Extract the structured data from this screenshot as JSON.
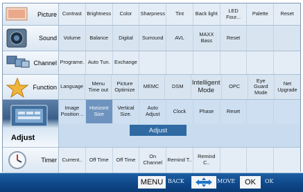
{
  "menu": {
    "rows": [
      {
        "label": "Picture",
        "icon": "picture-icon",
        "items": [
          "Contrast",
          "Brightness",
          "Color",
          "Sharpness",
          "Tint",
          "Back light",
          "LED Four...",
          "Palette",
          "Reset"
        ]
      },
      {
        "label": "Sound",
        "icon": "speaker-icon",
        "items": [
          "Volume",
          "Balance",
          "Digital",
          "Surround",
          "AVL",
          "MAXX Bass",
          "Reset",
          "",
          ""
        ]
      },
      {
        "label": "Channel",
        "icon": "channel-icon",
        "items": [
          "Programe.",
          "Auto Tun.",
          "Exchange",
          "",
          "",
          "",
          "",
          "",
          ""
        ]
      },
      {
        "label": "Function",
        "icon": "star-icon",
        "items": [
          "Language",
          "Menu Time out",
          "Picture Optimize",
          "MEMC",
          "DSM",
          "Intelligent Mode",
          "OPC",
          "Eye Guard Mode",
          "Net Upgrade"
        ]
      },
      {
        "label": "Adjust",
        "icon": "display-icon",
        "items": [
          "Image Position ..",
          "Horizont Size",
          "Vertical Size.",
          "Auto Adjust",
          "Clock",
          "Phase",
          "Reset",
          "",
          ""
        ]
      },
      {
        "label": "Timer",
        "icon": "clock-icon",
        "items": [
          "Current..",
          "Off Time",
          "Off Time",
          "On Channel",
          "Remind T..",
          "Remind C..",
          "",
          "",
          ""
        ]
      }
    ],
    "active_row": "Adjust",
    "selected_item": "Horizont Size",
    "submenu_title": "Adjust"
  },
  "footer": {
    "menu_key": "MENU",
    "menu_action": "BACK",
    "nav_icon": "move-arrows-icon",
    "nav_action": "MOVE",
    "ok_key": "OK",
    "ok_action": "OK"
  },
  "colors": {
    "footer_bg": "#0f4a8c",
    "selected_item": "#6e93bf",
    "adjust_bar": "#2f6aa2"
  }
}
